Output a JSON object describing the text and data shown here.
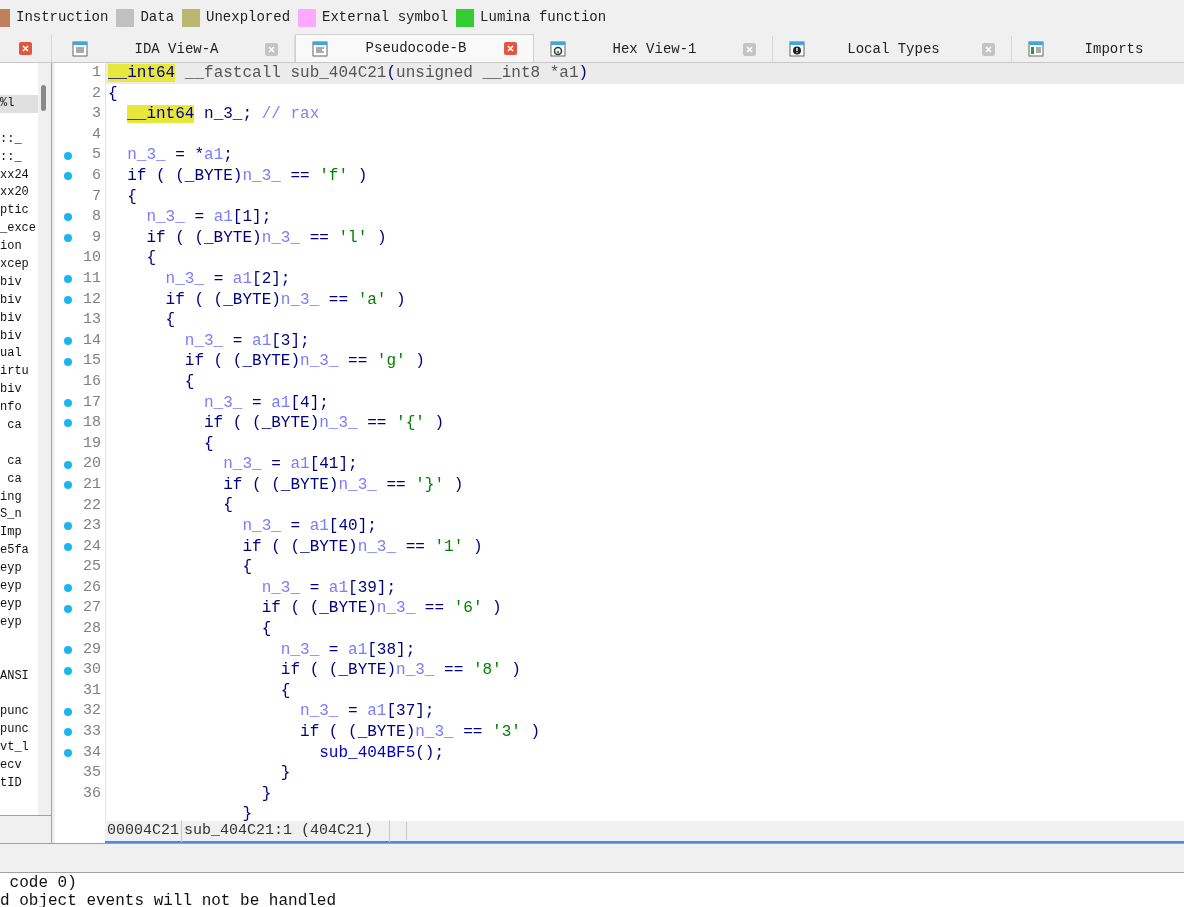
{
  "legend": [
    {
      "label": "Instruction",
      "color": "#c0805c"
    },
    {
      "label": "Data",
      "color": "#c0c0c0"
    },
    {
      "label": "Unexplored",
      "color": "#b8b870"
    },
    {
      "label": "External symbol",
      "color": "#ffa8ff"
    },
    {
      "label": "Lumina function",
      "color": "#33cc33"
    }
  ],
  "tabs": [
    {
      "label": "IDA View-A",
      "kind": "listing",
      "selected": false
    },
    {
      "label": "Pseudocode-B",
      "kind": "pseudocode",
      "selected": true
    },
    {
      "label": "Hex View-1",
      "kind": "hex",
      "selected": false
    },
    {
      "label": "Local Types",
      "kind": "types",
      "selected": false
    },
    {
      "label": "Imports",
      "kind": "imports",
      "selected": false
    }
  ],
  "side_list": [
    {
      "kind": "header",
      "text": "%l"
    },
    {
      "kind": "blank"
    },
    {
      "text": "::_",
      "selected": false,
      "blank_before": false
    },
    {
      "text": "::_",
      "selected": false,
      "blank_before": false
    },
    {
      "text": "xx24",
      "selected": false,
      "blank_before": false
    },
    {
      "text": "xx20",
      "selected": false,
      "blank_before": false
    },
    {
      "text": "ptic",
      "selected": false,
      "blank_before": false
    },
    {
      "text": "_exce",
      "selected": false,
      "blank_before": false
    },
    {
      "text": "ion",
      "selected": false,
      "blank_before": false
    },
    {
      "text": "xcep",
      "selected": false,
      "blank_before": false
    },
    {
      "text": "biv",
      "selected": false,
      "blank_before": false
    },
    {
      "text": "biv",
      "selected": false,
      "blank_before": false
    },
    {
      "text": "biv",
      "selected": false,
      "blank_before": false
    },
    {
      "text": "biv",
      "selected": false,
      "blank_before": false
    },
    {
      "text": "ual",
      "selected": false,
      "blank_before": false
    },
    {
      "text": "irtu",
      "selected": false,
      "blank_before": false
    },
    {
      "text": "biv",
      "selected": false,
      "blank_before": false
    },
    {
      "text": "nfo",
      "selected": false,
      "blank_before": false
    },
    {
      "text": " ca",
      "selected": false,
      "blank_before": false
    },
    {
      "kind": "blank"
    },
    {
      "text": " ca",
      "selected": false,
      "blank_before": false
    },
    {
      "text": " ca",
      "selected": false,
      "blank_before": false
    },
    {
      "text": "ing",
      "selected": false,
      "blank_before": false
    },
    {
      "text": "S_n",
      "selected": false,
      "blank_before": false
    },
    {
      "text": "Imp",
      "selected": false,
      "blank_before": false
    },
    {
      "text": "e5fa",
      "selected": false,
      "blank_before": false
    },
    {
      "text": "eyp",
      "selected": false,
      "blank_before": false
    },
    {
      "text": "eyp",
      "selected": false,
      "blank_before": false
    },
    {
      "text": "eyp",
      "selected": false,
      "blank_before": false
    },
    {
      "text": "eyp",
      "selected": false,
      "blank_before": false
    },
    {
      "kind": "blank"
    },
    {
      "kind": "blank"
    },
    {
      "text": "ANSI",
      "selected": false,
      "blank_before": false
    },
    {
      "kind": "blank"
    },
    {
      "text": "punc",
      "selected": false,
      "blank_before": false
    },
    {
      "text": "punc",
      "selected": false,
      "blank_before": false
    },
    {
      "text": "vt_l",
      "selected": false,
      "blank_before": false
    },
    {
      "text": "ecv",
      "selected": false,
      "blank_before": false
    },
    {
      "text": "tID",
      "selected": false,
      "blank_before": false
    }
  ],
  "code_lines": [
    {
      "number": "1",
      "bullet": false,
      "current": true,
      "tokens": [
        {
          "kind": "type",
          "text": "__int64"
        },
        {
          "kind": "proto",
          "text": " __fastcall sub_404C21"
        },
        {
          "kind": "plain",
          "text": "("
        },
        {
          "kind": "proto",
          "text": "unsigned __int8 *a1"
        },
        {
          "kind": "plain",
          "text": ")"
        }
      ]
    },
    {
      "number": "2",
      "bullet": false,
      "current": false,
      "tokens": [
        {
          "kind": "plain",
          "text": "{"
        }
      ]
    },
    {
      "number": "3",
      "bullet": false,
      "current": false,
      "tokens": [
        {
          "kind": "type",
          "text": "  __int64"
        },
        {
          "kind": "plain",
          "text": " n_3_; "
        },
        {
          "kind": "cmt",
          "text": "// rax"
        }
      ]
    },
    {
      "number": "4",
      "bullet": false
    },
    {
      "number": "5",
      "bullet": true,
      "current": false,
      "tokens": [
        {
          "kind": "var",
          "text": "  n_3_"
        },
        {
          "kind": "plain",
          "text": " = *"
        },
        {
          "kind": "var",
          "text": "a1"
        },
        {
          "kind": "plain",
          "text": ";"
        }
      ]
    },
    {
      "number": "6",
      "bullet": true,
      "current": false,
      "tokens": [
        {
          "kind": "plain",
          "text": "  if ( (_BYTE)"
        },
        {
          "kind": "var",
          "text": "n_3_"
        },
        {
          "kind": "plain",
          "text": " == "
        },
        {
          "kind": "str",
          "text": "'f'"
        },
        {
          "kind": "plain",
          "text": " )"
        }
      ]
    },
    {
      "number": "7",
      "bullet": false,
      "current": false,
      "tokens": [
        {
          "kind": "plain",
          "text": "  {"
        }
      ]
    },
    {
      "number": "8",
      "bullet": true,
      "current": false,
      "tokens": [
        {
          "kind": "var",
          "text": "    n_3_"
        },
        {
          "kind": "plain",
          "text": " = "
        },
        {
          "kind": "var",
          "text": "a1"
        },
        {
          "kind": "plain",
          "text": "[1];"
        }
      ]
    },
    {
      "number": "9",
      "bullet": true,
      "current": false,
      "tokens": [
        {
          "kind": "plain",
          "text": "    if ( (_BYTE)"
        },
        {
          "kind": "var",
          "text": "n_3_"
        },
        {
          "kind": "plain",
          "text": " == "
        },
        {
          "kind": "str",
          "text": "'l'"
        },
        {
          "kind": "plain",
          "text": " )"
        }
      ]
    },
    {
      "number": "10",
      "bullet": false,
      "current": false,
      "tokens": [
        {
          "kind": "plain",
          "text": "    {"
        }
      ]
    },
    {
      "number": "11",
      "bullet": true,
      "current": false,
      "tokens": [
        {
          "kind": "var",
          "text": "      n_3_"
        },
        {
          "kind": "plain",
          "text": " = "
        },
        {
          "kind": "var",
          "text": "a1"
        },
        {
          "kind": "plain",
          "text": "[2];"
        }
      ]
    },
    {
      "number": "12",
      "bullet": true,
      "current": false,
      "tokens": [
        {
          "kind": "plain",
          "text": "      if ( (_BYTE)"
        },
        {
          "kind": "var",
          "text": "n_3_"
        },
        {
          "kind": "plain",
          "text": " == "
        },
        {
          "kind": "str",
          "text": "'a'"
        },
        {
          "kind": "plain",
          "text": " )"
        }
      ]
    },
    {
      "number": "13",
      "bullet": false,
      "current": false,
      "tokens": [
        {
          "kind": "plain",
          "text": "      {"
        }
      ]
    },
    {
      "number": "14",
      "bullet": true,
      "current": false,
      "tokens": [
        {
          "kind": "var",
          "text": "        n_3_"
        },
        {
          "kind": "plain",
          "text": " = "
        },
        {
          "kind": "var",
          "text": "a1"
        },
        {
          "kind": "plain",
          "text": "[3];"
        }
      ]
    },
    {
      "number": "15",
      "bullet": true,
      "current": false,
      "tokens": [
        {
          "kind": "plain",
          "text": "        if ( (_BYTE)"
        },
        {
          "kind": "var",
          "text": "n_3_"
        },
        {
          "kind": "plain",
          "text": " == "
        },
        {
          "kind": "str",
          "text": "'g'"
        },
        {
          "kind": "plain",
          "text": " )"
        }
      ]
    },
    {
      "number": "16",
      "bullet": false,
      "current": false,
      "tokens": [
        {
          "kind": "plain",
          "text": "        {"
        }
      ]
    },
    {
      "number": "17",
      "bullet": true,
      "current": false,
      "tokens": [
        {
          "kind": "var",
          "text": "          n_3_"
        },
        {
          "kind": "plain",
          "text": " = "
        },
        {
          "kind": "var",
          "text": "a1"
        },
        {
          "kind": "plain",
          "text": "[4];"
        }
      ]
    },
    {
      "number": "18",
      "bullet": true,
      "current": false,
      "tokens": [
        {
          "kind": "plain",
          "text": "          if ( (_BYTE)"
        },
        {
          "kind": "var",
          "text": "n_3_"
        },
        {
          "kind": "plain",
          "text": " == "
        },
        {
          "kind": "str",
          "text": "'{'"
        },
        {
          "kind": "plain",
          "text": " )"
        }
      ]
    },
    {
      "number": "19",
      "bullet": false,
      "current": false,
      "tokens": [
        {
          "kind": "plain",
          "text": "          {"
        }
      ]
    },
    {
      "number": "20",
      "bullet": true,
      "current": false,
      "tokens": [
        {
          "kind": "var",
          "text": "            n_3_"
        },
        {
          "kind": "plain",
          "text": " = "
        },
        {
          "kind": "var",
          "text": "a1"
        },
        {
          "kind": "plain",
          "text": "[41];"
        }
      ]
    },
    {
      "number": "21",
      "bullet": true,
      "current": false,
      "tokens": [
        {
          "kind": "plain",
          "text": "            if ( (_BYTE)"
        },
        {
          "kind": "var",
          "text": "n_3_"
        },
        {
          "kind": "plain",
          "text": " == "
        },
        {
          "kind": "str",
          "text": "'}'"
        },
        {
          "kind": "plain",
          "text": " )"
        }
      ]
    },
    {
      "number": "22",
      "bullet": false,
      "current": false,
      "tokens": [
        {
          "kind": "plain",
          "text": "            {"
        }
      ]
    },
    {
      "number": "23",
      "bullet": true,
      "current": false,
      "tokens": [
        {
          "kind": "var",
          "text": "              n_3_"
        },
        {
          "kind": "plain",
          "text": " = "
        },
        {
          "kind": "var",
          "text": "a1"
        },
        {
          "kind": "plain",
          "text": "[40];"
        }
      ]
    },
    {
      "number": "24",
      "bullet": true,
      "current": false,
      "tokens": [
        {
          "kind": "plain",
          "text": "              if ( (_BYTE)"
        },
        {
          "kind": "var",
          "text": "n_3_"
        },
        {
          "kind": "plain",
          "text": " == "
        },
        {
          "kind": "str",
          "text": "'1'"
        },
        {
          "kind": "plain",
          "text": " )"
        }
      ]
    },
    {
      "number": "25",
      "bullet": false,
      "current": false,
      "tokens": [
        {
          "kind": "plain",
          "text": "              {"
        }
      ]
    },
    {
      "number": "26",
      "bullet": true,
      "current": false,
      "tokens": [
        {
          "kind": "var",
          "text": "                n_3_"
        },
        {
          "kind": "plain",
          "text": " = "
        },
        {
          "kind": "var",
          "text": "a1"
        },
        {
          "kind": "plain",
          "text": "[39];"
        }
      ]
    },
    {
      "number": "27",
      "bullet": true,
      "current": false,
      "tokens": [
        {
          "kind": "plain",
          "text": "                if ( (_BYTE)"
        },
        {
          "kind": "var",
          "text": "n_3_"
        },
        {
          "kind": "plain",
          "text": " == "
        },
        {
          "kind": "str",
          "text": "'6'"
        },
        {
          "kind": "plain",
          "text": " )"
        }
      ]
    },
    {
      "number": "28",
      "bullet": false,
      "current": false,
      "tokens": [
        {
          "kind": "plain",
          "text": "                {"
        }
      ]
    },
    {
      "number": "29",
      "bullet": true,
      "current": false,
      "tokens": [
        {
          "kind": "var",
          "text": "                  n_3_"
        },
        {
          "kind": "plain",
          "text": " = "
        },
        {
          "kind": "var",
          "text": "a1"
        },
        {
          "kind": "plain",
          "text": "[38];"
        }
      ]
    },
    {
      "number": "30",
      "bullet": true,
      "current": false,
      "tokens": [
        {
          "kind": "plain",
          "text": "                  if ( (_BYTE)"
        },
        {
          "kind": "var",
          "text": "n_3_"
        },
        {
          "kind": "plain",
          "text": " == "
        },
        {
          "kind": "str",
          "text": "'8'"
        },
        {
          "kind": "plain",
          "text": " )"
        }
      ]
    },
    {
      "number": "31",
      "bullet": false,
      "current": false,
      "tokens": [
        {
          "kind": "plain",
          "text": "                  {"
        }
      ]
    },
    {
      "number": "32",
      "bullet": true,
      "current": false,
      "tokens": [
        {
          "kind": "var",
          "text": "                    n_3_"
        },
        {
          "kind": "plain",
          "text": " = "
        },
        {
          "kind": "var",
          "text": "a1"
        },
        {
          "kind": "plain",
          "text": "[37];"
        }
      ]
    },
    {
      "number": "33",
      "bullet": true,
      "current": false,
      "tokens": [
        {
          "kind": "plain",
          "text": "                    if ( (_BYTE)"
        },
        {
          "kind": "var",
          "text": "n_3_"
        },
        {
          "kind": "plain",
          "text": " == "
        },
        {
          "kind": "str",
          "text": "'3'"
        },
        {
          "kind": "plain",
          "text": " )"
        }
      ]
    },
    {
      "number": "34",
      "bullet": true,
      "current": false,
      "tokens": [
        {
          "kind": "func",
          "text": "                      sub_404BF5"
        },
        {
          "kind": "plain",
          "text": "();"
        }
      ]
    },
    {
      "number": "35",
      "bullet": false,
      "current": false,
      "tokens": [
        {
          "kind": "plain",
          "text": "                  }"
        }
      ]
    },
    {
      "number": "36",
      "bullet": false,
      "current": false,
      "tokens": [
        {
          "kind": "plain",
          "text": "                }"
        }
      ]
    },
    {
      "tokens": [
        {
          "kind": "plain",
          "text": "              }"
        }
      ]
    }
  ],
  "status_bar": {
    "address": "00004C21",
    "location": "sub_404C21:1 (404C21)"
  },
  "output": [
    " code 0)",
    "d object events will not be handled"
  ]
}
